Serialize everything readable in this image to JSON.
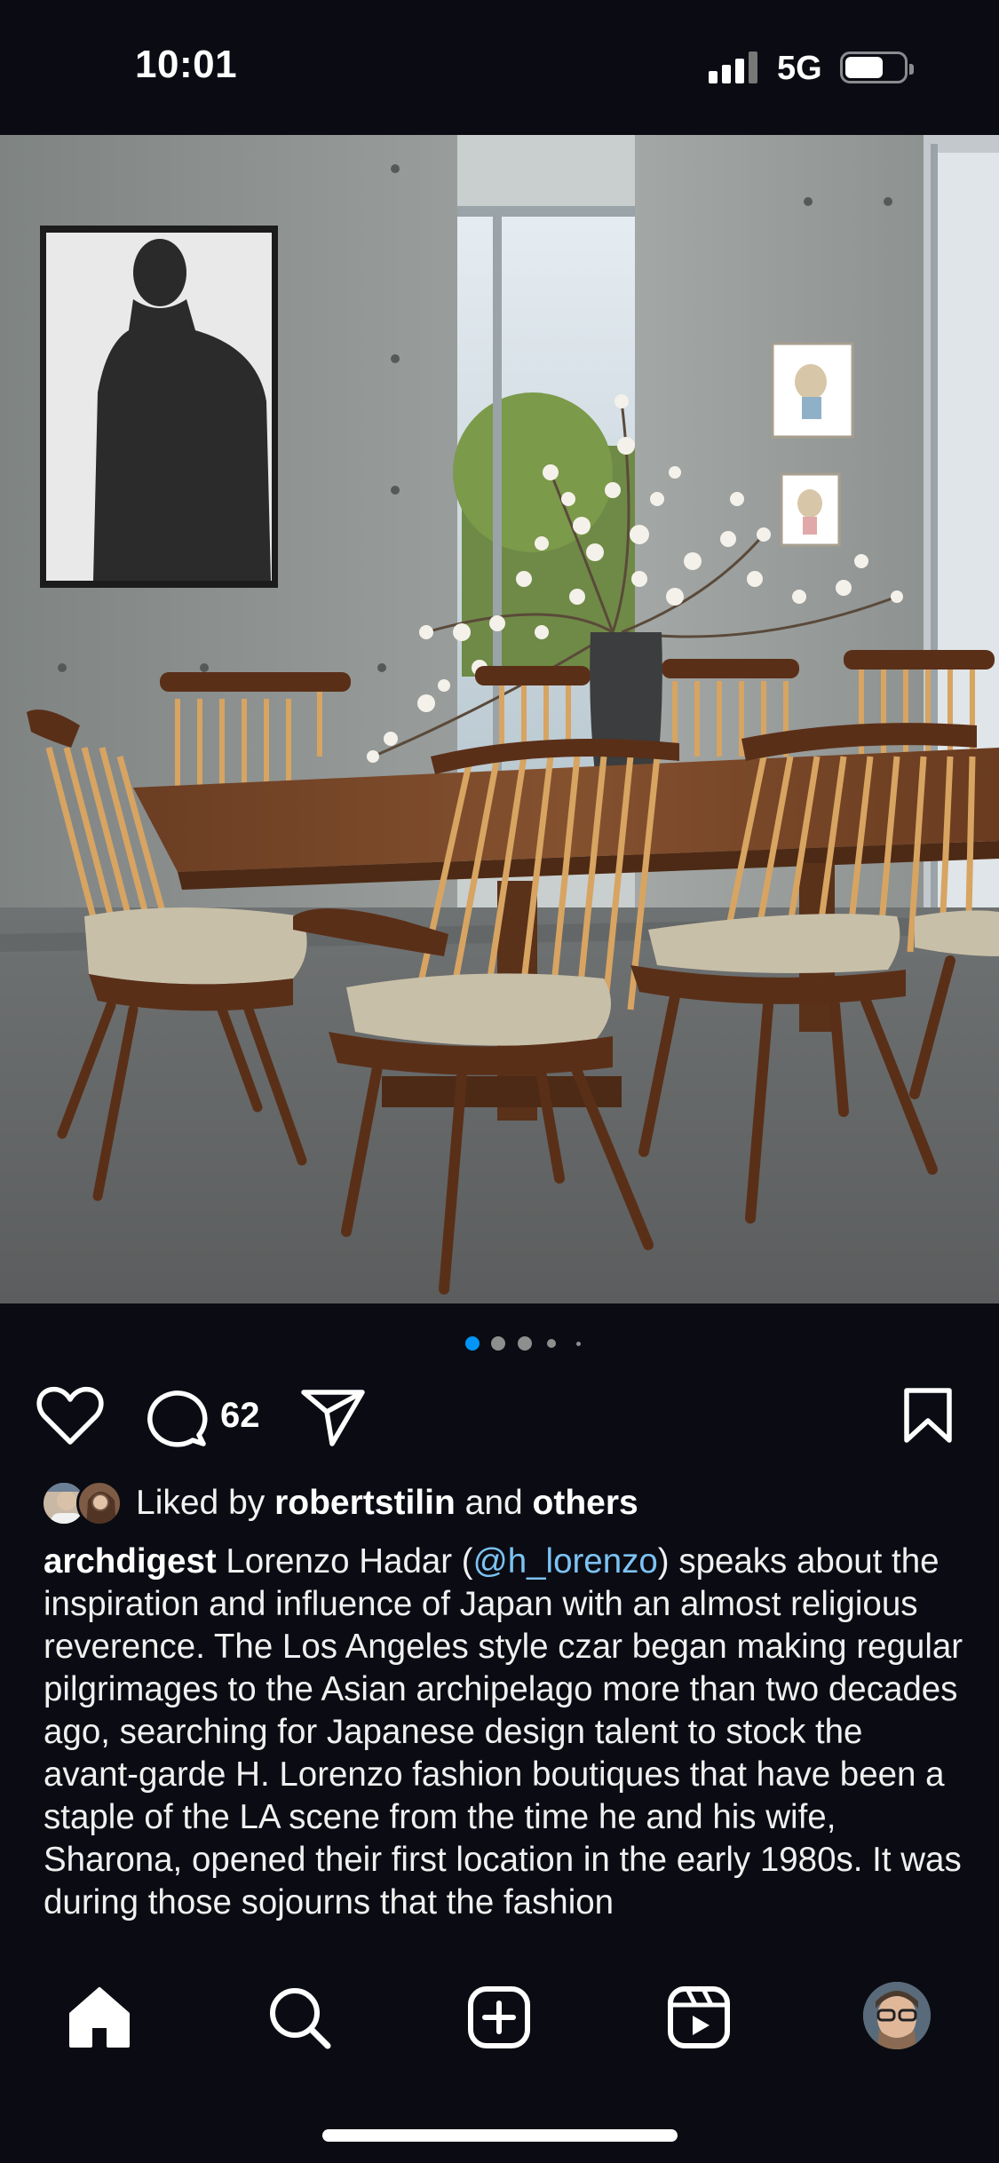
{
  "status_bar": {
    "time": "10:01",
    "network": "5G"
  },
  "post": {
    "image_alt": "Dining room with concrete walls, long wooden table, spindle-back chairs and cherry blossom branches",
    "carousel": {
      "count": 5,
      "active_index": 0
    },
    "comment_count": "62",
    "liked_by_prefix": "Liked by ",
    "liked_by_user": "robertstilin",
    "liked_by_and": " and ",
    "liked_by_others": "others",
    "caption": {
      "username": "archdigest",
      "text_1": " Lorenzo Hadar (",
      "mention": "@h_lorenzo",
      "text_2": ") speaks about the inspiration and influence of Japan with an almost religious reverence. The Los Angeles style czar began making regular pilgrimages to the Asian archipelago more than two decades ago, searching for Japanese design talent to stock the avant-garde H. Lorenzo fashion boutiques that have been a staple of the LA scene from the time he and his wife, Sharona, opened their first location in the early 1980s. It was during those sojourns that the fashion"
    }
  },
  "icons": {
    "like": "heart-icon",
    "comment": "comment-bubble-icon",
    "share": "paper-plane-icon",
    "save": "bookmark-icon"
  },
  "nav": {
    "items": [
      "home-icon",
      "search-icon",
      "create-icon",
      "reels-icon",
      "profile-avatar"
    ]
  },
  "colors": {
    "background": "#0b0c13",
    "accent": "#0095f6",
    "mention": "#7cc3f5"
  }
}
